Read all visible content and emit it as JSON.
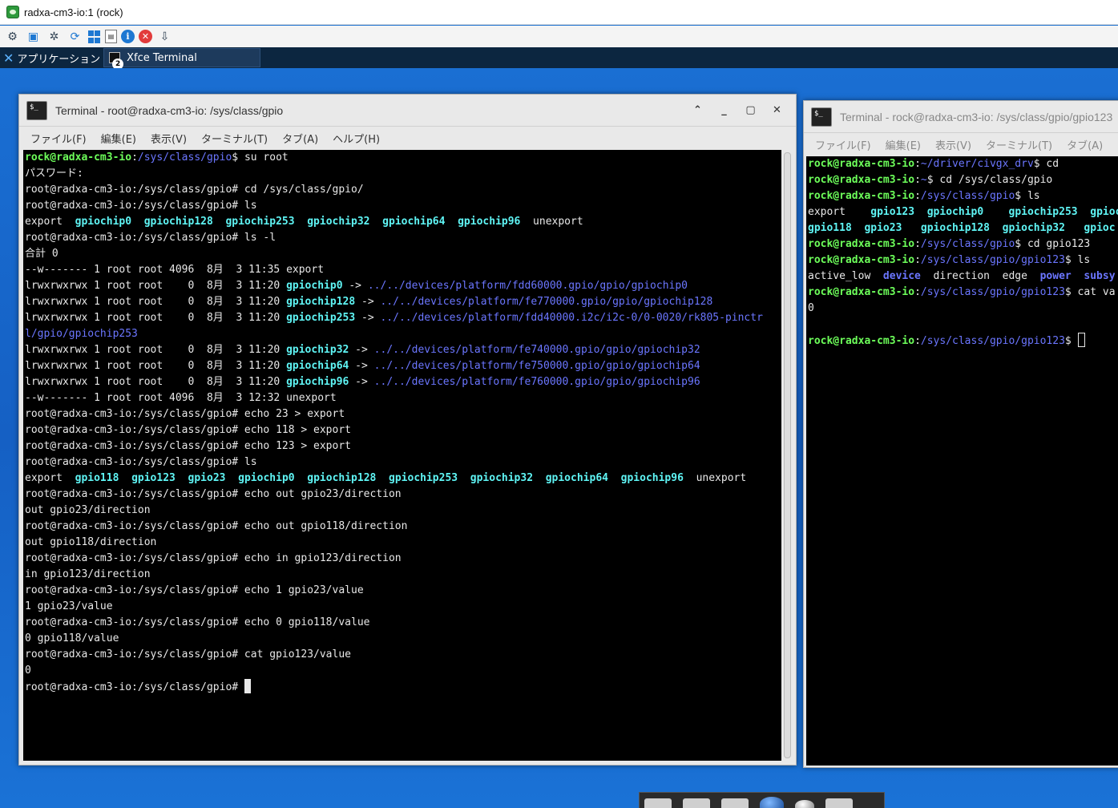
{
  "vnc": {
    "title": "radxa-cm3-io:1 (rock)"
  },
  "panel": {
    "apps_menu_label": "アプリケーション",
    "task_label": "Xfce Terminal",
    "task_badge": "2"
  },
  "main_terminal": {
    "title": "Terminal - root@radxa-cm3-io: /sys/class/gpio",
    "menu": [
      "ファイル(F)",
      "編集(E)",
      "表示(V)",
      "ターミナル(T)",
      "タブ(A)",
      "ヘルプ(H)"
    ],
    "lines": [
      [
        {
          "t": "rock@radxa-cm3-io",
          "c": "green"
        },
        {
          "t": ":"
        },
        {
          "t": "/sys/class/gpio",
          "c": "blue"
        },
        {
          "t": "$ su root"
        }
      ],
      [
        {
          "t": "パスワード:"
        }
      ],
      [
        {
          "t": "root@radxa-cm3-io:/sys/class/gpio# cd /sys/class/gpio/"
        }
      ],
      [
        {
          "t": "root@radxa-cm3-io:/sys/class/gpio# ls"
        }
      ],
      [
        {
          "t": "export  "
        },
        {
          "t": "gpiochip0",
          "c": "cyan"
        },
        {
          "t": "  "
        },
        {
          "t": "gpiochip128",
          "c": "cyan"
        },
        {
          "t": "  "
        },
        {
          "t": "gpiochip253",
          "c": "cyan"
        },
        {
          "t": "  "
        },
        {
          "t": "gpiochip32",
          "c": "cyan"
        },
        {
          "t": "  "
        },
        {
          "t": "gpiochip64",
          "c": "cyan"
        },
        {
          "t": "  "
        },
        {
          "t": "gpiochip96",
          "c": "cyan"
        },
        {
          "t": "  unexport"
        }
      ],
      [
        {
          "t": "root@radxa-cm3-io:/sys/class/gpio# ls -l"
        }
      ],
      [
        {
          "t": "合計 0"
        }
      ],
      [
        {
          "t": "--w------- 1 root root 4096  8月  3 11:35 export"
        }
      ],
      [
        {
          "t": "lrwxrwxrwx 1 root root    0  8月  3 11:20 "
        },
        {
          "t": "gpiochip0",
          "c": "cyan"
        },
        {
          "t": " -> "
        },
        {
          "t": "../../devices/platform/fdd60000.gpio/gpio/gpiochip0",
          "c": "link"
        }
      ],
      [
        {
          "t": "lrwxrwxrwx 1 root root    0  8月  3 11:20 "
        },
        {
          "t": "gpiochip128",
          "c": "cyan"
        },
        {
          "t": " -> "
        },
        {
          "t": "../../devices/platform/fe770000.gpio/gpio/gpiochip128",
          "c": "link"
        }
      ],
      [
        {
          "t": "lrwxrwxrwx 1 root root    0  8月  3 11:20 "
        },
        {
          "t": "gpiochip253",
          "c": "cyan"
        },
        {
          "t": " -> "
        },
        {
          "t": "../../devices/platform/fdd40000.i2c/i2c-0/0-0020/rk805-pinctr",
          "c": "link"
        }
      ],
      [
        {
          "t": "l/gpio/gpiochip253",
          "c": "link"
        }
      ],
      [
        {
          "t": "lrwxrwxrwx 1 root root    0  8月  3 11:20 "
        },
        {
          "t": "gpiochip32",
          "c": "cyan"
        },
        {
          "t": " -> "
        },
        {
          "t": "../../devices/platform/fe740000.gpio/gpio/gpiochip32",
          "c": "link"
        }
      ],
      [
        {
          "t": "lrwxrwxrwx 1 root root    0  8月  3 11:20 "
        },
        {
          "t": "gpiochip64",
          "c": "cyan"
        },
        {
          "t": " -> "
        },
        {
          "t": "../../devices/platform/fe750000.gpio/gpio/gpiochip64",
          "c": "link"
        }
      ],
      [
        {
          "t": "lrwxrwxrwx 1 root root    0  8月  3 11:20 "
        },
        {
          "t": "gpiochip96",
          "c": "cyan"
        },
        {
          "t": " -> "
        },
        {
          "t": "../../devices/platform/fe760000.gpio/gpio/gpiochip96",
          "c": "link"
        }
      ],
      [
        {
          "t": "--w------- 1 root root 4096  8月  3 12:32 unexport"
        }
      ],
      [
        {
          "t": "root@radxa-cm3-io:/sys/class/gpio# echo 23 > export"
        }
      ],
      [
        {
          "t": "root@radxa-cm3-io:/sys/class/gpio# echo 118 > export"
        }
      ],
      [
        {
          "t": "root@radxa-cm3-io:/sys/class/gpio# echo 123 > export"
        }
      ],
      [
        {
          "t": "root@radxa-cm3-io:/sys/class/gpio# ls"
        }
      ],
      [
        {
          "t": "export  "
        },
        {
          "t": "gpio118",
          "c": "cyan"
        },
        {
          "t": "  "
        },
        {
          "t": "gpio123",
          "c": "cyan"
        },
        {
          "t": "  "
        },
        {
          "t": "gpio23",
          "c": "cyan"
        },
        {
          "t": "  "
        },
        {
          "t": "gpiochip0",
          "c": "cyan"
        },
        {
          "t": "  "
        },
        {
          "t": "gpiochip128",
          "c": "cyan"
        },
        {
          "t": "  "
        },
        {
          "t": "gpiochip253",
          "c": "cyan"
        },
        {
          "t": "  "
        },
        {
          "t": "gpiochip32",
          "c": "cyan"
        },
        {
          "t": "  "
        },
        {
          "t": "gpiochip64",
          "c": "cyan"
        },
        {
          "t": "  "
        },
        {
          "t": "gpiochip96",
          "c": "cyan"
        },
        {
          "t": "  unexport"
        }
      ],
      [
        {
          "t": "root@radxa-cm3-io:/sys/class/gpio# echo out gpio23/direction"
        }
      ],
      [
        {
          "t": "out gpio23/direction"
        }
      ],
      [
        {
          "t": "root@radxa-cm3-io:/sys/class/gpio# echo out gpio118/direction"
        }
      ],
      [
        {
          "t": "out gpio118/direction"
        }
      ],
      [
        {
          "t": "root@radxa-cm3-io:/sys/class/gpio# echo in gpio123/direction"
        }
      ],
      [
        {
          "t": "in gpio123/direction"
        }
      ],
      [
        {
          "t": "root@radxa-cm3-io:/sys/class/gpio# echo 1 gpio23/value"
        }
      ],
      [
        {
          "t": "1 gpio23/value"
        }
      ],
      [
        {
          "t": "root@radxa-cm3-io:/sys/class/gpio# echo 0 gpio118/value"
        }
      ],
      [
        {
          "t": "0 gpio118/value"
        }
      ],
      [
        {
          "t": "root@radxa-cm3-io:/sys/class/gpio# cat gpio123/value"
        }
      ],
      [
        {
          "t": "0"
        }
      ],
      [
        {
          "t": "root@radxa-cm3-io:/sys/class/gpio# "
        },
        {
          "cursor": "solid"
        }
      ]
    ]
  },
  "side_terminal": {
    "title": "Terminal - rock@radxa-cm3-io: /sys/class/gpio/gpio123",
    "menu": [
      "ファイル(F)",
      "編集(E)",
      "表示(V)",
      "ターミナル(T)",
      "タブ(A)"
    ],
    "lines": [
      [
        {
          "t": "rock@radxa-cm3-io",
          "c": "green"
        },
        {
          "t": ":"
        },
        {
          "t": "~/driver/civgx_drv",
          "c": "blue"
        },
        {
          "t": "$ cd"
        }
      ],
      [
        {
          "t": "rock@radxa-cm3-io",
          "c": "green"
        },
        {
          "t": ":"
        },
        {
          "t": "~",
          "c": "blue"
        },
        {
          "t": "$ cd /sys/class/gpio"
        }
      ],
      [
        {
          "t": "rock@radxa-cm3-io",
          "c": "green"
        },
        {
          "t": ":"
        },
        {
          "t": "/sys/class/gpio",
          "c": "blue"
        },
        {
          "t": "$ ls"
        }
      ],
      [
        {
          "t": "export    "
        },
        {
          "t": "gpio123",
          "c": "cyan"
        },
        {
          "t": "  "
        },
        {
          "t": "gpiochip0",
          "c": "cyan"
        },
        {
          "t": "    "
        },
        {
          "t": "gpiochip253",
          "c": "cyan"
        },
        {
          "t": "  "
        },
        {
          "t": "gpioc",
          "c": "cyan"
        }
      ],
      [
        {
          "t": "gpio118",
          "c": "cyan"
        },
        {
          "t": "  "
        },
        {
          "t": "gpio23",
          "c": "cyan"
        },
        {
          "t": "   "
        },
        {
          "t": "gpiochip128",
          "c": "cyan"
        },
        {
          "t": "  "
        },
        {
          "t": "gpiochip32",
          "c": "cyan"
        },
        {
          "t": "   "
        },
        {
          "t": "gpioc",
          "c": "cyan"
        }
      ],
      [
        {
          "t": "rock@radxa-cm3-io",
          "c": "green"
        },
        {
          "t": ":"
        },
        {
          "t": "/sys/class/gpio",
          "c": "blue"
        },
        {
          "t": "$ cd gpio123"
        }
      ],
      [
        {
          "t": "rock@radxa-cm3-io",
          "c": "green"
        },
        {
          "t": ":"
        },
        {
          "t": "/sys/class/gpio/gpio123",
          "c": "blue"
        },
        {
          "t": "$ ls"
        }
      ],
      [
        {
          "t": "active_low  "
        },
        {
          "t": "device",
          "c": "dir"
        },
        {
          "t": "  direction  edge  "
        },
        {
          "t": "power",
          "c": "dir"
        },
        {
          "t": "  "
        },
        {
          "t": "subsy",
          "c": "dir"
        }
      ],
      [
        {
          "t": "rock@radxa-cm3-io",
          "c": "green"
        },
        {
          "t": ":"
        },
        {
          "t": "/sys/class/gpio/gpio123",
          "c": "blue"
        },
        {
          "t": "$ cat va"
        }
      ],
      [
        {
          "t": "0"
        }
      ],
      [
        {
          "t": ""
        }
      ],
      [
        {
          "t": "rock@radxa-cm3-io",
          "c": "green"
        },
        {
          "t": ":"
        },
        {
          "t": "/sys/class/gpio/gpio123",
          "c": "blue"
        },
        {
          "t": "$ "
        },
        {
          "cursor": "hollow"
        }
      ]
    ]
  }
}
